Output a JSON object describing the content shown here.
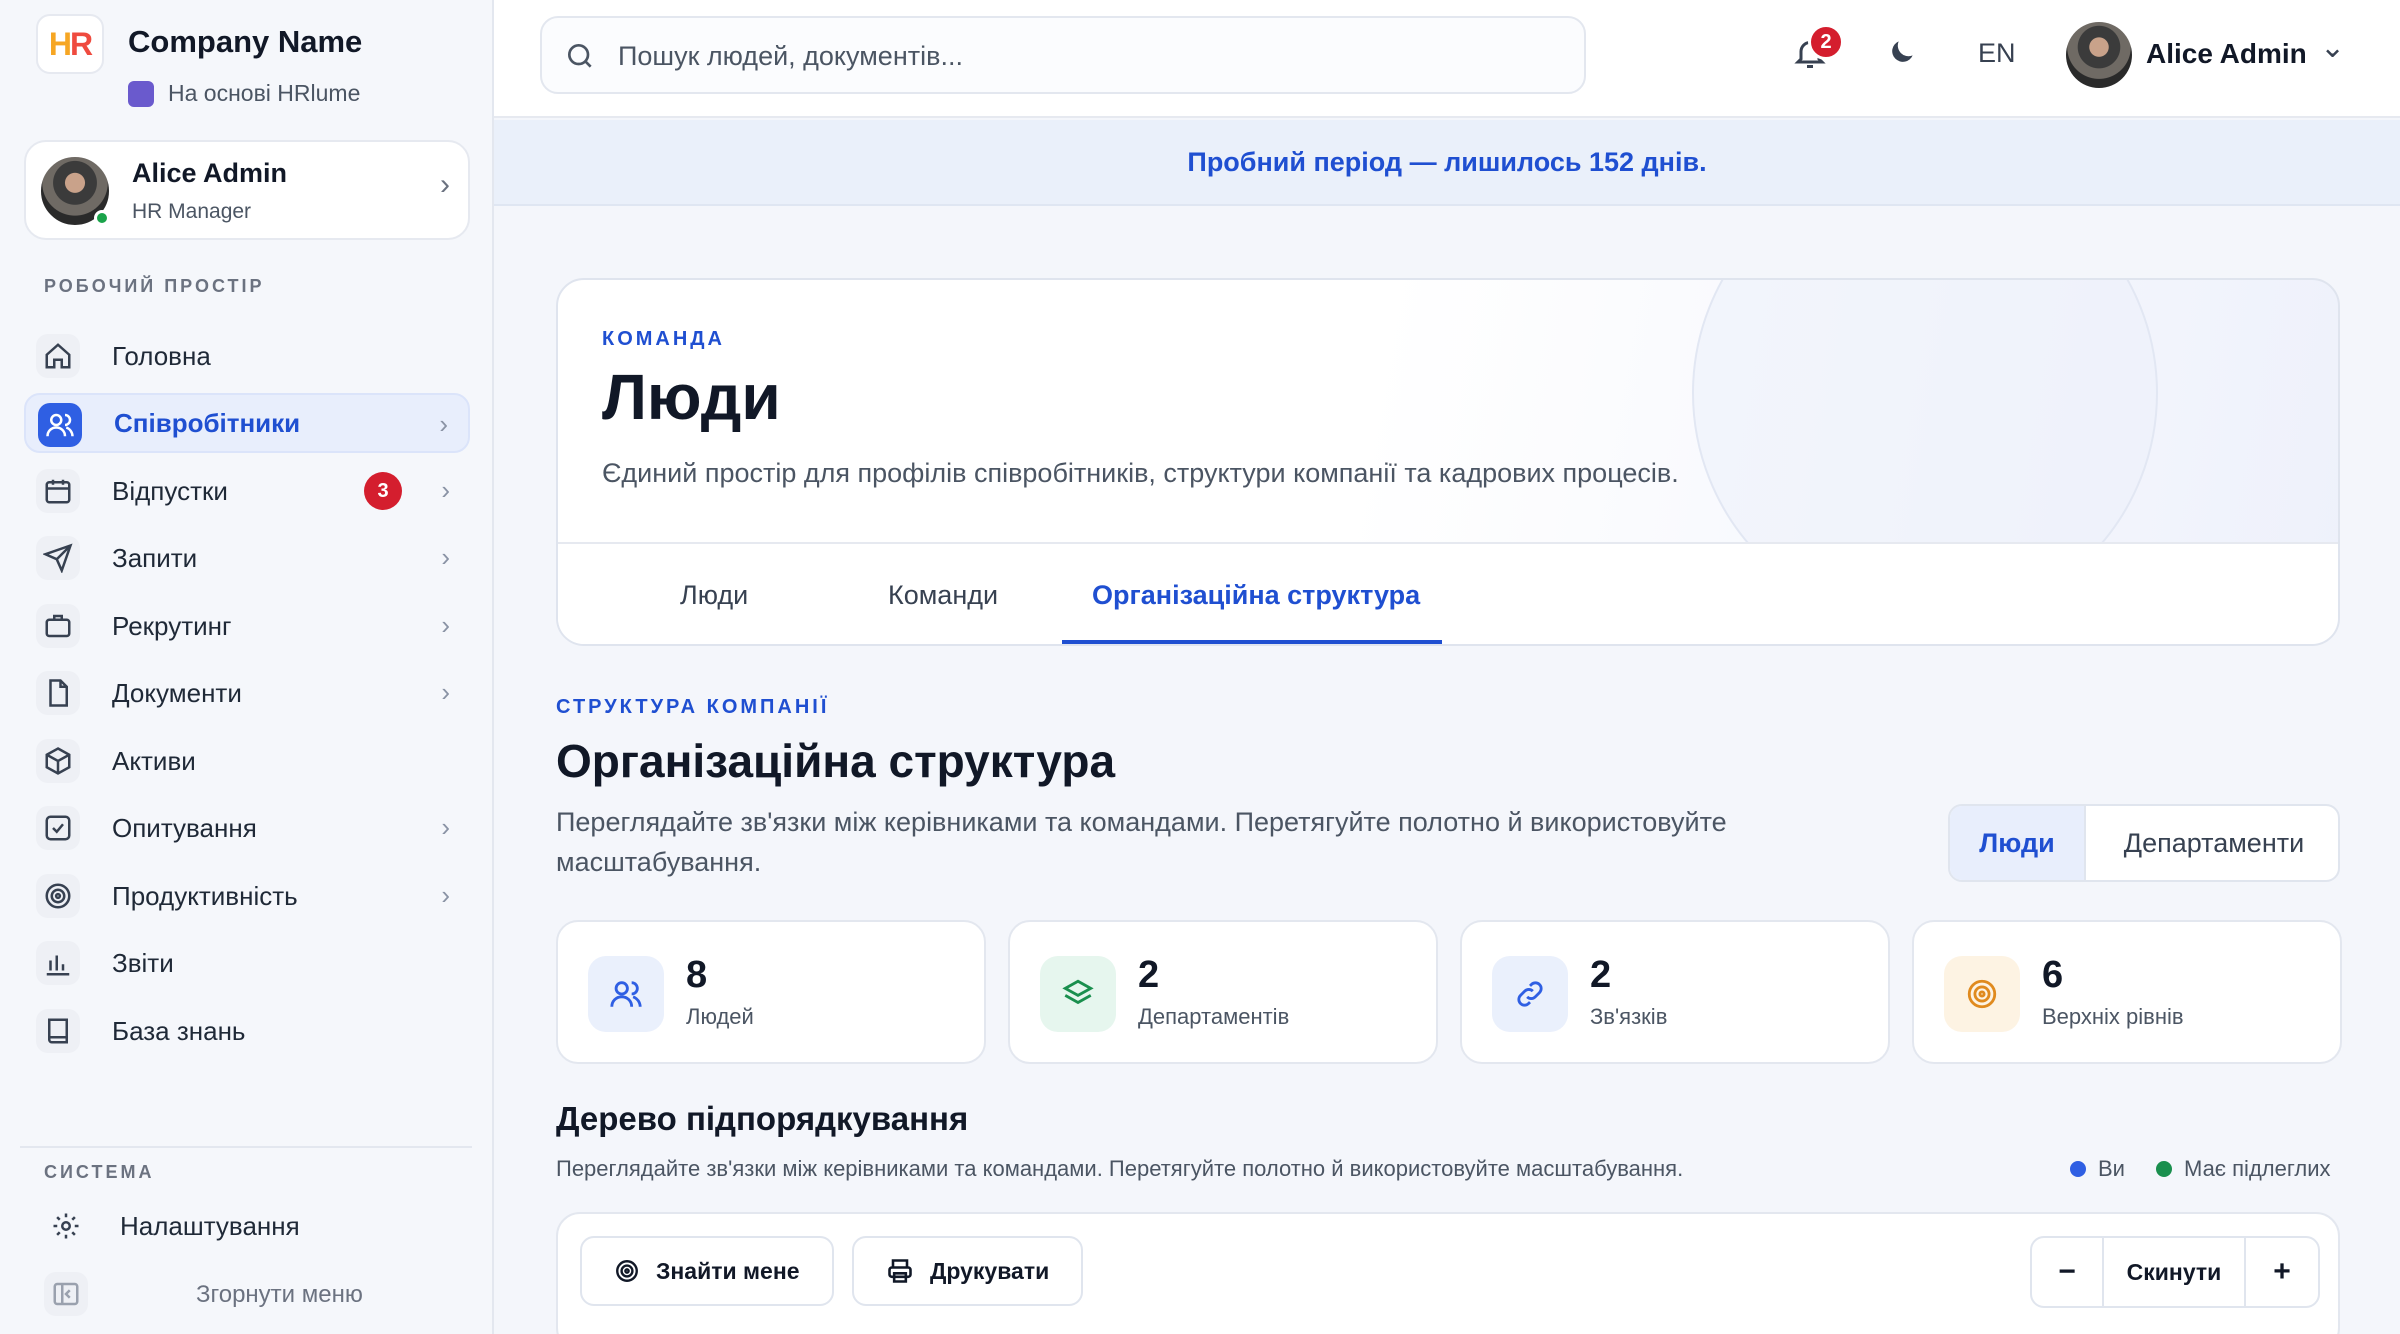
{
  "brand": {
    "logo": "HR",
    "name": "Company Name",
    "powered_by": "На основі HRlume"
  },
  "sidebar": {
    "user": {
      "name": "Alice Admin",
      "role": "HR Manager"
    },
    "workspace_label": "РОБОЧИЙ ПРОСТІР",
    "items": [
      {
        "label": "Головна",
        "icon": "home-icon"
      },
      {
        "label": "Співробітники",
        "icon": "users-icon",
        "active": true
      },
      {
        "label": "Відпустки",
        "icon": "calendar-icon",
        "badge": "3"
      },
      {
        "label": "Запити",
        "icon": "send-icon"
      },
      {
        "label": "Рекрутинг",
        "icon": "briefcase-icon"
      },
      {
        "label": "Документи",
        "icon": "document-icon"
      },
      {
        "label": "Активи",
        "icon": "box-icon"
      },
      {
        "label": "Опитування",
        "icon": "checkbox-icon"
      },
      {
        "label": "Продуктивність",
        "icon": "target-icon"
      },
      {
        "label": "Звіти",
        "icon": "bar-chart-icon"
      },
      {
        "label": "База знань",
        "icon": "book-icon"
      }
    ],
    "system_label": "СИСТЕМА",
    "settings_label": "Налаштування",
    "collapse_label": "Згорнути меню"
  },
  "topbar": {
    "search_placeholder": "Пошук людей, документів...",
    "notifications_count": "2",
    "language": "EN",
    "user_name": "Alice Admin"
  },
  "trial_banner": "Пробний період — лишилось 152 днів.",
  "hero": {
    "eyebrow": "КОМАНДА",
    "title": "Люди",
    "description": "Єдиний простір для профілів співробітників, структури компанії та кадрових процесів.",
    "tabs": [
      "Люди",
      "Команди",
      "Організаційна структура"
    ],
    "active_tab": "Організаційна структура"
  },
  "org": {
    "eyebrow": "СТРУКТУРА КОМПАНІЇ",
    "title": "Організаційна структура",
    "description": "Переглядайте зв'язки між керівниками та командами. Перетягуйте полотно й використовуйте масштабування.",
    "view_toggle": [
      "Люди",
      "Департаменти"
    ],
    "stats": [
      {
        "value": "8",
        "label": "Людей",
        "icon": "users-icon",
        "tint": "#eaf0fc",
        "color": "#2f5fe3"
      },
      {
        "value": "2",
        "label": "Департаментів",
        "icon": "layers-icon",
        "tint": "#e6f6ee",
        "color": "#1a8f4e"
      },
      {
        "value": "2",
        "label": "Зв'язків",
        "icon": "link-icon",
        "tint": "#eaf0fc",
        "color": "#2f5fe3"
      },
      {
        "value": "6",
        "label": "Верхніх рівнів",
        "icon": "target-icon",
        "tint": "#fdf3e3",
        "color": "#e08a1e"
      }
    ],
    "tree_title": "Дерево підпорядкування",
    "tree_description": "Переглядайте зв'язки між керівниками та командами. Перетягуйте полотно й використовуйте масштабування.",
    "legend": [
      {
        "label": "Ви",
        "color": "#2f5fe3"
      },
      {
        "label": "Має підлеглих",
        "color": "#1a8f4e"
      }
    ],
    "toolbar": {
      "find_me": "Знайти мене",
      "print": "Друкувати",
      "zoom_out": "−",
      "reset": "Скинути",
      "zoom_in": "+"
    }
  }
}
